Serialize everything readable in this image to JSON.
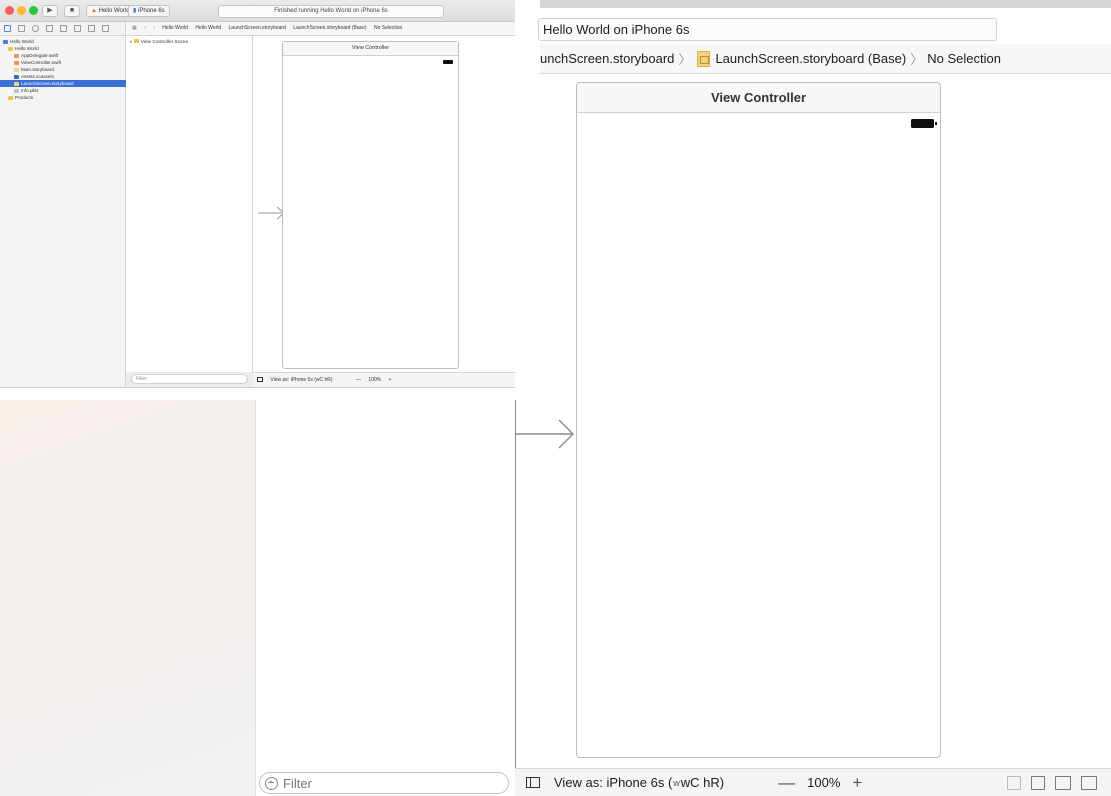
{
  "window": {
    "scheme": "Hello World",
    "device": "iPhone 6s",
    "status": "Finished running Hello World on iPhone 6s",
    "status_large": "Hello World on iPhone 6s"
  },
  "mini_jump": [
    "Hello World",
    "Hello World",
    "LaunchScreen.storyboard",
    "LaunchScreen.storyboard (Base)",
    "No Selection"
  ],
  "navigator": {
    "items": [
      {
        "label": "Hello World",
        "level": 0,
        "selected": false
      },
      {
        "label": "Hello World",
        "level": 1,
        "selected": false
      },
      {
        "label": "AppDelegate.swift",
        "level": 2,
        "selected": false
      },
      {
        "label": "ViewController.swift",
        "level": 2,
        "selected": false
      },
      {
        "label": "Main.storyboard",
        "level": 2,
        "selected": false
      },
      {
        "label": "Assets.xcassets",
        "level": 2,
        "selected": false
      },
      {
        "label": "LaunchScreen.storyboard",
        "level": 2,
        "selected": true
      },
      {
        "label": "Info.plist",
        "level": 2,
        "selected": false
      },
      {
        "label": "Products",
        "level": 1,
        "selected": false
      }
    ]
  },
  "outline": {
    "scene": "View Controller Scene",
    "filter_placeholder": "Filter"
  },
  "jumpbar_large": {
    "file": "unchScreen.storyboard",
    "base": "LaunchScreen.storyboard (Base)",
    "selection": "No Selection"
  },
  "canvas": {
    "view_controller_title": "View Controller",
    "view_as": "View as: iPhone 6s (",
    "size_classes": "wC hR)",
    "zoom": "100%",
    "zoom_minus": "—",
    "zoom_plus": "+"
  }
}
